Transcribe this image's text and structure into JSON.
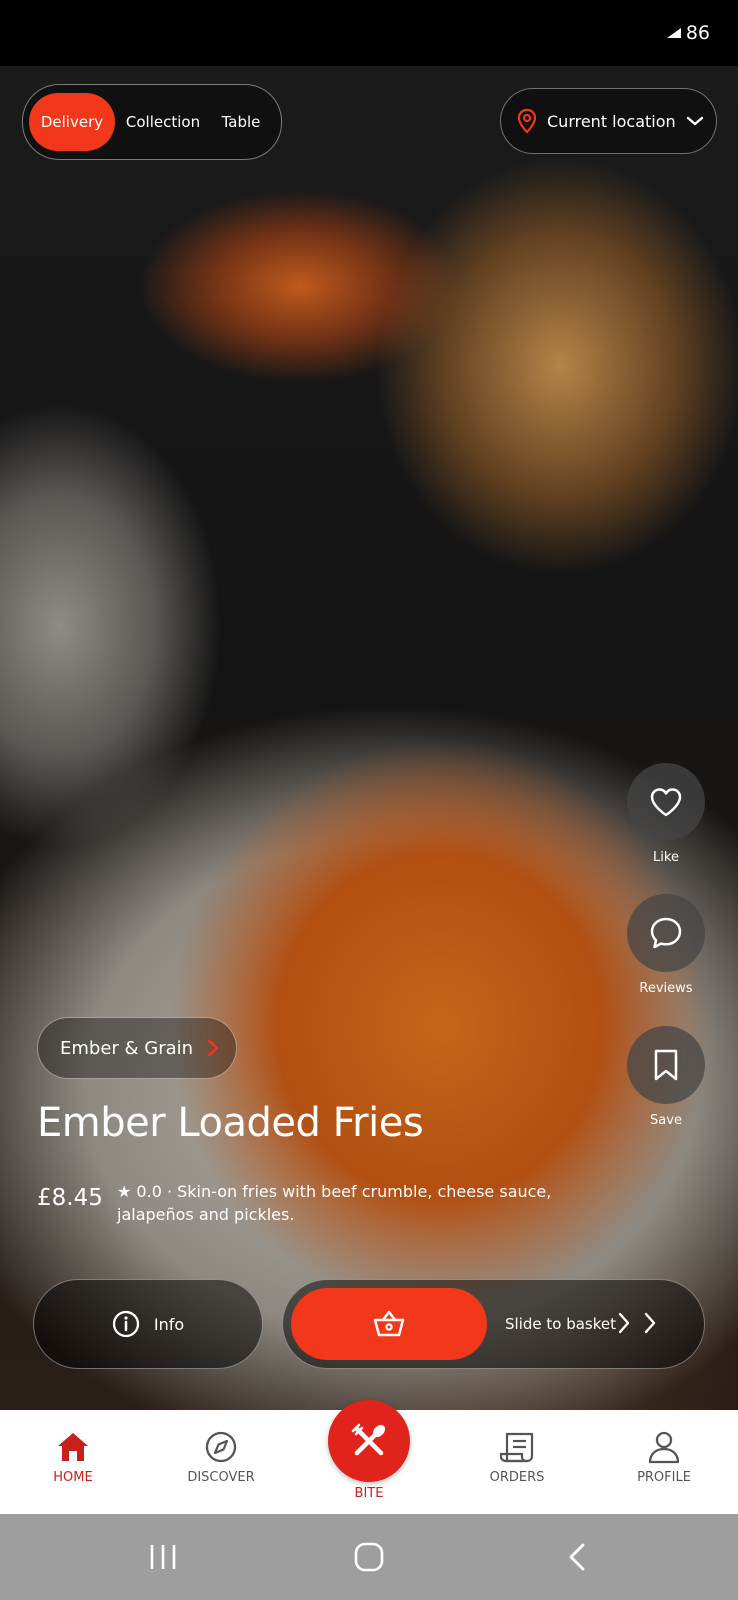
{
  "status_bar": {
    "battery": "86"
  },
  "order_modes": {
    "active": "Delivery",
    "items": [
      "Delivery",
      "Collection",
      "Table"
    ]
  },
  "location": {
    "label": "Current location"
  },
  "actions": {
    "like": "Like",
    "reviews": "Reviews",
    "save": "Save"
  },
  "vendor": {
    "name": "Ember & Grain"
  },
  "dish": {
    "title": "Ember Loaded Fries",
    "price": "£8.45",
    "rating_line": "★ 0.0 · Skin-on fries with beef crumble, cheese sauce, jalapeños and pickles."
  },
  "cta": {
    "info": "Info",
    "slide": "Slide to basket"
  },
  "nav": {
    "home": "HOME",
    "discover": "DISCOVER",
    "bite": "BITE",
    "orders": "ORDERS",
    "profile": "PROFILE"
  },
  "colors": {
    "accent": "#f2371a",
    "nav_active": "#c8201a",
    "nav_inactive": "#555555"
  }
}
